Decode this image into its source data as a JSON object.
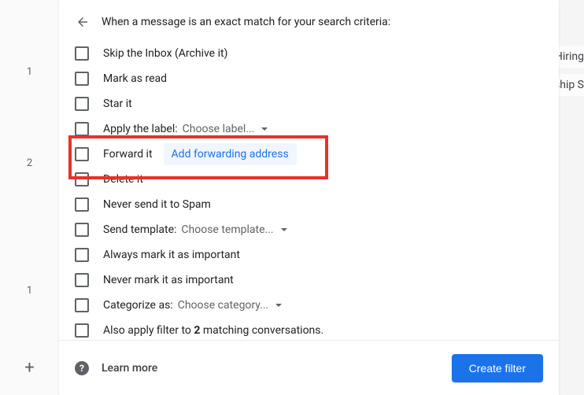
{
  "gutter": {
    "items": [
      "1",
      "2",
      "1"
    ],
    "plus": "+"
  },
  "header": {
    "title": "When a message is an exact match for your search criteria:"
  },
  "options": {
    "skip_inbox": "Skip the Inbox (Archive it)",
    "mark_read": "Mark as read",
    "star": "Star it",
    "apply_label": "Apply the label:",
    "apply_label_value": "Choose label...",
    "forward": "Forward it",
    "forward_link": "Add forwarding address",
    "delete": "Delete it",
    "never_spam": "Never send it to Spam",
    "send_template": "Send template:",
    "send_template_value": "Choose template...",
    "always_important": "Always mark it as important",
    "never_important": "Never mark it as important",
    "categorize": "Categorize as:",
    "categorize_value": "Choose category...",
    "also_apply_pre": "Also apply filter to ",
    "also_apply_count": "2",
    "also_apply_post": " matching conversations."
  },
  "footer": {
    "learn_more": "Learn more",
    "create": "Create filter"
  },
  "background": {
    "snippet1": "Hiring",
    "snippet2": "ership S"
  }
}
